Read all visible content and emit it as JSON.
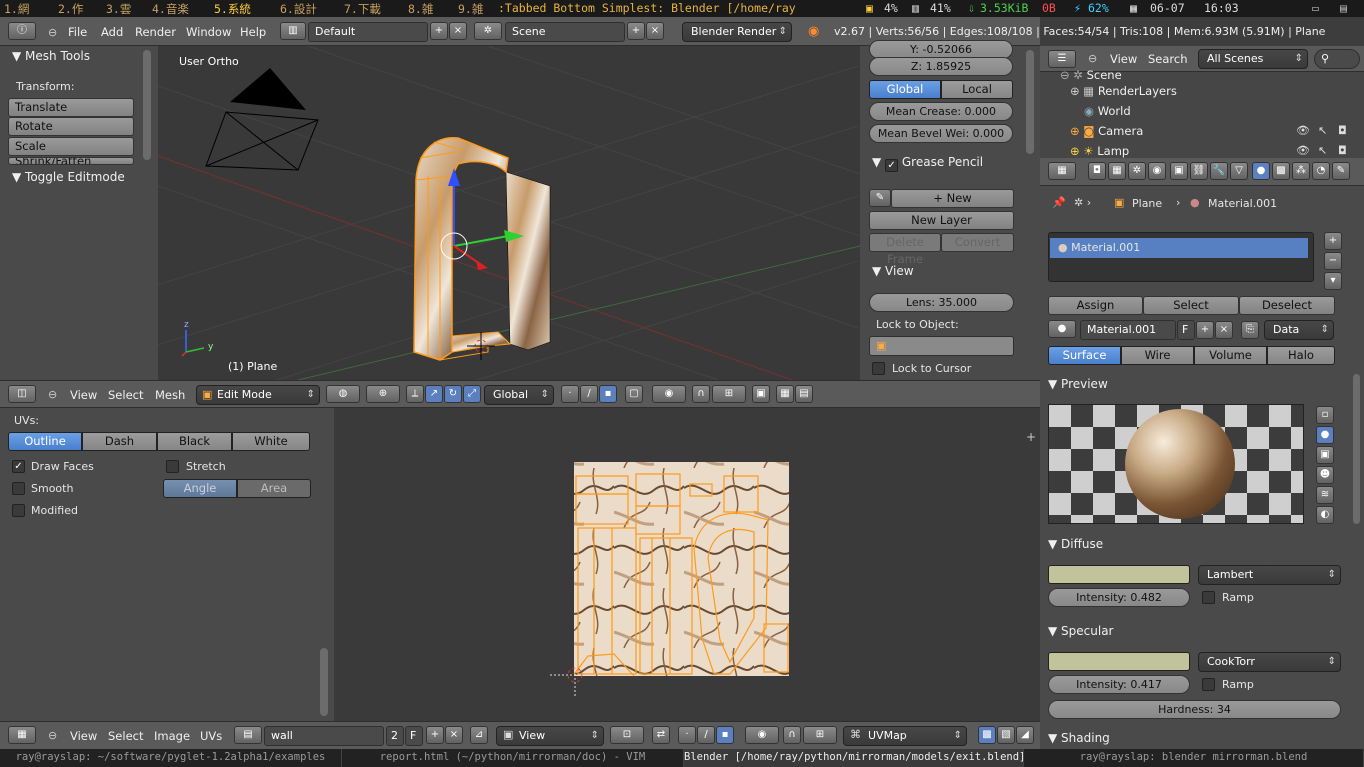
{
  "system_bar": {
    "workspaces": [
      "1.網",
      "2.作",
      "3.雲",
      "4.音楽",
      "5.系統",
      "6.設計",
      "7.下載",
      "8.雑",
      "9.雑"
    ],
    "active_workspace": 5,
    "window_title": ":Tabbed Bottom Simplest: Blender [/home/ray",
    "cpu": "4%",
    "mem": "41%",
    "net_up": "3.53KiB",
    "net_down": "0B",
    "battery": "62%",
    "date": "06-07",
    "time": "16:03"
  },
  "info_header": {
    "menus": [
      "File",
      "Add",
      "Render",
      "Window",
      "Help"
    ],
    "layout": "Default",
    "scene": "Scene",
    "engine": "Blender Render",
    "stats": "v2.67 | Verts:56/56 | Edges:108/108 | Faces:54/54 | Tris:108 | Mem:6.93M (5.91M) | Plane"
  },
  "tool_panel": {
    "title": "Mesh Tools",
    "transform_label": "Transform:",
    "buttons": [
      "Translate",
      "Rotate",
      "Scale",
      "Shrink/Fatten"
    ],
    "toggle": "Toggle Editmode"
  },
  "viewport": {
    "view_name": "User Ortho",
    "object_label": "(1) Plane",
    "axis_z": "z",
    "axis_y": "y"
  },
  "n_panel": {
    "y_field": "Y: -0.52066",
    "z_field": "Z: 1.85925",
    "global": "Global",
    "local": "Local",
    "mean_crease": "Mean Crease: 0.000",
    "mean_bevel": "Mean Bevel Wei: 0.000",
    "grease_pencil": "Grease Pencil",
    "new": "New",
    "new_layer": "New Layer",
    "delete_frame": "Delete Frame",
    "convert": "Convert",
    "view_title": "View",
    "lens": "Lens: 35.000",
    "lock_to_object": "Lock to Object:",
    "lock_to_cursor": "Lock to Cursor"
  },
  "view3d_header": {
    "menus": [
      "View",
      "Select",
      "Mesh"
    ],
    "mode": "Edit Mode",
    "orientation": "Global"
  },
  "uv_props": {
    "title": "UVs:",
    "modes": [
      "Outline",
      "Dash",
      "Black",
      "White"
    ],
    "draw_faces": "Draw Faces",
    "smooth": "Smooth",
    "modified": "Modified",
    "stretch": "Stretch",
    "angle": "Angle",
    "area": "Area"
  },
  "uv_header": {
    "menus": [
      "View",
      "Select",
      "Image",
      "UVs"
    ],
    "image_name": "wall",
    "users": "2",
    "fake": "F",
    "view_mode": "View",
    "uv_map": "UVMap"
  },
  "outliner": {
    "menus": [
      "View",
      "Search"
    ],
    "filter": "All Scenes",
    "items": [
      "Scene",
      "RenderLayers",
      "World",
      "Camera",
      "Lamp"
    ]
  },
  "properties": {
    "breadcrumb_object": "Plane",
    "breadcrumb_material": "Material.001",
    "slot": "Material.001",
    "assign": "Assign",
    "select": "Select",
    "deselect": "Deselect",
    "material_name": "Material.001",
    "fake_user": "F",
    "link": "Data",
    "tabs": [
      "Surface",
      "Wire",
      "Volume",
      "Halo"
    ],
    "preview_title": "Preview",
    "diffuse_title": "Diffuse",
    "diffuse_shader": "Lambert",
    "diffuse_intensity": "Intensity: 0.482",
    "ramp": "Ramp",
    "specular_title": "Specular",
    "specular_shader": "CookTorr",
    "specular_intensity": "Intensity: 0.417",
    "hardness": "Hardness: 34",
    "shading_title": "Shading",
    "diffuse_color": "#c1c49a",
    "specular_color": "#c1c49a"
  },
  "taskbar": {
    "items": [
      "ray@rayslap: ~/software/pyglet-1.2alpha1/examples",
      "report.html (~/python/mirrorman/doc) - VIM",
      "Blender [/home/ray/python/mirrorman/models/exit.blend]",
      "ray@rayslap: blender mirrorman.blend"
    ]
  }
}
